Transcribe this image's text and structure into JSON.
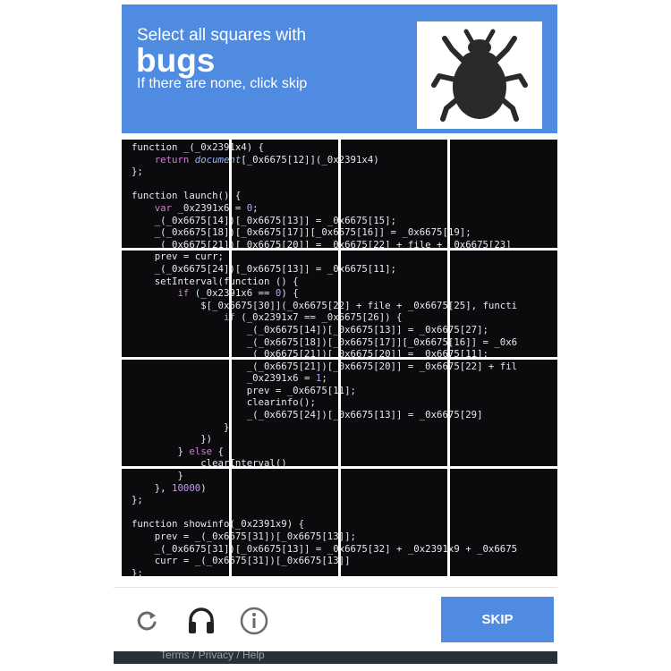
{
  "header": {
    "instruction": "Select all squares with",
    "keyword": "bugs",
    "subtext": "If there are none, click skip",
    "sample_icon": "bug-icon"
  },
  "grid": {
    "rows": 4,
    "cols": 4,
    "code_lines": [
      "function _(_0x2391x4) {",
      "    return document[_0x6675[12]](_0x2391x4)",
      "};",
      "",
      "function launch() {",
      "    var _0x2391x6 = 0;",
      "    _(_0x6675[14])[_0x6675[13]] = _0x6675[15];",
      "    _(_0x6675[18])[_0x6675[17]][_0x6675[16]] = _0x6675[19];",
      "    _(_0x6675[21])[_0x6675[20]] = _0x6675[22] + file + _0x6675[23]",
      "    prev = curr;",
      "    _(_0x6675[24])[_0x6675[13]] = _0x6675[11];",
      "    setInterval(function () {",
      "        if (_0x2391x6 == 0) {",
      "            $[_0x6675[30]](_0x6675[22] + file + _0x6675[25], functi",
      "                if (_0x2391x7 == _0x6675[26]) {",
      "                    _(_0x6675[14])[_0x6675[13]] = _0x6675[27];",
      "                    _(_0x6675[18])[_0x6675[17]][_0x6675[16]] = _0x6",
      "                    _(_0x6675[21])[_0x6675[20]] = _0x6675[11];",
      "                    _(_0x6675[21])[_0x6675[20]] = _0x6675[22] + fil",
      "                    _0x2391x6 = 1;",
      "                    prev = _0x6675[11];",
      "                    clearinfo();",
      "                    _(_0x6675[24])[_0x6675[13]] = _0x6675[29]",
      "                }",
      "            })",
      "        } else {",
      "            clearInterval()",
      "        }",
      "    }, 10000)",
      "};",
      "",
      "function showinfo(_0x2391x9) {",
      "    prev = _(_0x6675[31])[_0x6675[13]];",
      "    _(_0x6675[31])[_0x6675[13]] = _0x6675[32] + _0x2391x9 + _0x6675",
      "    curr = _(_0x6675[31])[_0x6675[13]]",
      "};"
    ]
  },
  "footer": {
    "reload_icon": "reload-icon",
    "audio_icon": "headphones-icon",
    "info_icon": "info-icon",
    "skip_label": "SKIP",
    "below_text": "Terms / Privacy / Help"
  },
  "colors": {
    "accent": "#4f8be0",
    "code_bg": "#0b0b0d",
    "keyword": "#cf7fd8",
    "number": "#c59cf0"
  }
}
